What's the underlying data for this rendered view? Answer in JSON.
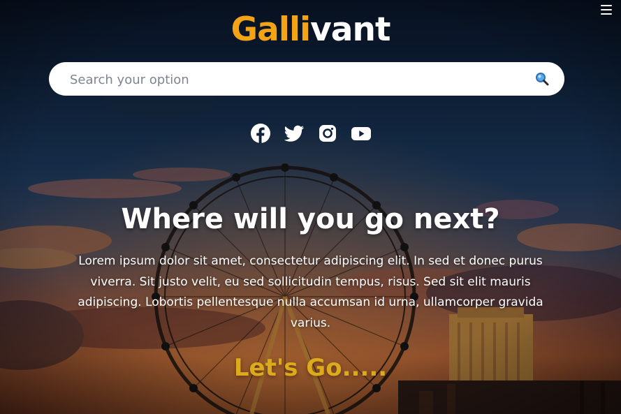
{
  "header": {
    "logo_part1": "Galli",
    "logo_part2": "vant",
    "logo_color_part1": "#f2a316",
    "logo_color_part2": "#ffffff",
    "menu_icon": "hamburger-menu-icon"
  },
  "search": {
    "placeholder": "Search your option",
    "value": "",
    "icon": "magnifying-glass-icon"
  },
  "social": {
    "icons": [
      "facebook-icon",
      "twitter-icon",
      "instagram-icon",
      "youtube-icon"
    ]
  },
  "hero": {
    "headline": "Where will you go next?",
    "description": "Lorem ipsum dolor sit amet, consectetur adipiscing elit. In sed et donec purus viverra. Sit justo velit, eu sed sollicitudin tempus, risus. Sed sit elit mauris adipiscing. Lobortis pellentesque nulla accumsan id urna, ullamcorper gravida varius.",
    "cta_label": "Let's Go.....",
    "cta_color": "#dcaa1b"
  }
}
